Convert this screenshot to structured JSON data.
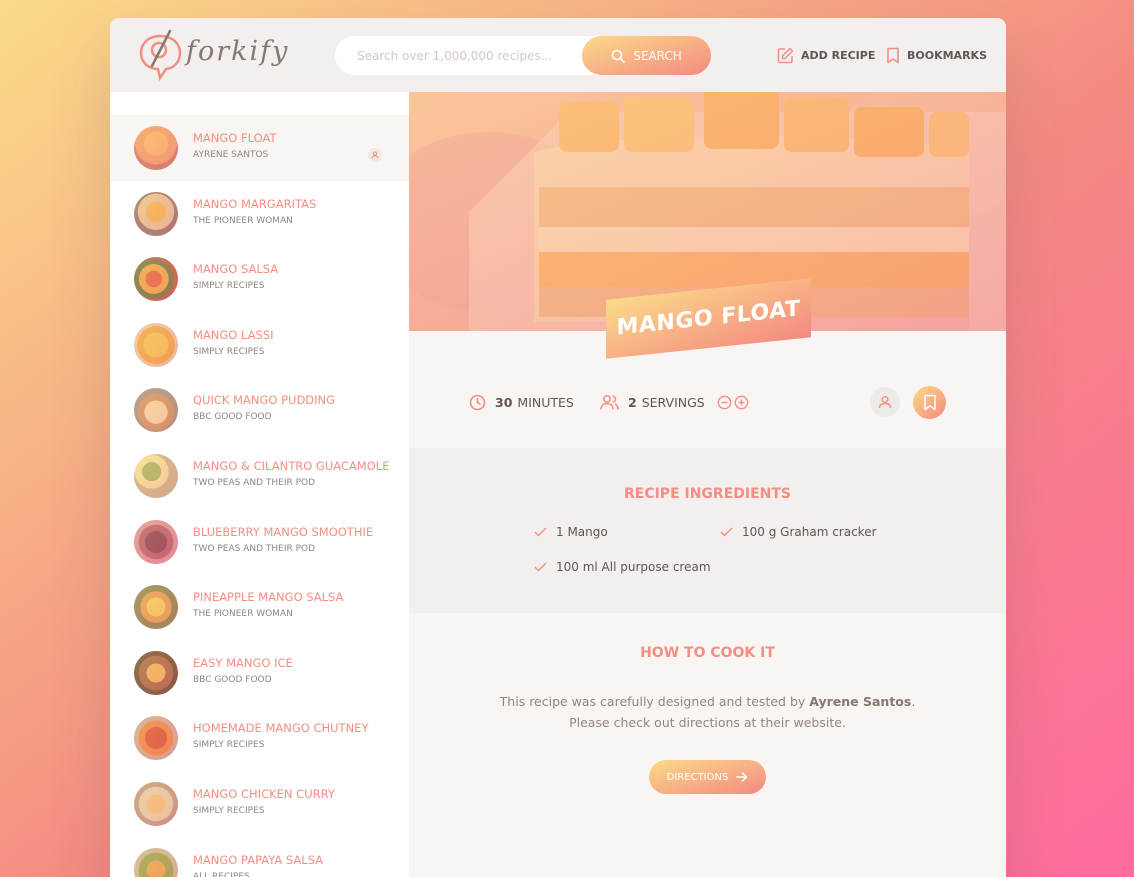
{
  "app": {
    "logo_text": "forkify",
    "colors": {
      "primary": "#f38e82",
      "accent_light": "#fbdb89",
      "accent_dark": "#f48982",
      "text": "#615551",
      "muted": "#918581"
    }
  },
  "header": {
    "search_placeholder": "Search over 1,000,000 recipes...",
    "search_value": "",
    "search_label": "SEARCH",
    "add_recipe_label": "ADD RECIPE",
    "bookmarks_label": "BOOKMARKS"
  },
  "results": [
    {
      "title": "MANGO FLOAT",
      "publisher": "AYRENE SANTOS",
      "active": true,
      "user_generated": true,
      "thumb": "cake-orange"
    },
    {
      "title": "MANGO MARGARITAS",
      "publisher": "THE PIONEER WOMAN",
      "active": false,
      "thumb": "drink-orange"
    },
    {
      "title": "MANGO SALSA",
      "publisher": "SIMPLY RECIPES",
      "active": false,
      "thumb": "salsa-red"
    },
    {
      "title": "MANGO LASSI",
      "publisher": "SIMPLY RECIPES",
      "active": false,
      "thumb": "lassi-yellow"
    },
    {
      "title": "QUICK MANGO PUDDING",
      "publisher": "BBC GOOD FOOD",
      "active": false,
      "thumb": "pudding-cream"
    },
    {
      "title": "MANGO & CILANTRO GUACAMOLE",
      "publisher": "TWO PEAS AND THEIR POD",
      "active": false,
      "thumb": "guac-green"
    },
    {
      "title": "BLUEBERRY MANGO SMOOTHIE",
      "publisher": "TWO PEAS AND THEIR POD",
      "active": false,
      "thumb": "smoothie-purple"
    },
    {
      "title": "PINEAPPLE MANGO SALSA",
      "publisher": "THE PIONEER WOMAN",
      "active": false,
      "thumb": "salsa-yellow"
    },
    {
      "title": "EASY MANGO ICE",
      "publisher": "BBC GOOD FOOD",
      "active": false,
      "thumb": "ice-brown"
    },
    {
      "title": "HOMEMADE MANGO CHUTNEY",
      "publisher": "SIMPLY RECIPES",
      "active": false,
      "thumb": "chutney-red"
    },
    {
      "title": "MANGO CHICKEN CURRY",
      "publisher": "SIMPLY RECIPES",
      "active": false,
      "thumb": "curry-cream"
    },
    {
      "title": "MANGO PAPAYA SALSA",
      "publisher": "ALL RECIPES",
      "active": false,
      "thumb": "salsa-green"
    }
  ],
  "recipe": {
    "title": "MANGO FLOAT",
    "cooking_time": "30",
    "cooking_time_unit": "MINUTES",
    "servings": "2",
    "servings_unit": "SERVINGS",
    "ingredients_title": "RECIPE INGREDIENTS",
    "ingredients": [
      "1 Mango",
      "100 g Graham cracker",
      "100 ml All purpose cream"
    ],
    "cook_title": "HOW TO COOK IT",
    "cook_text_before": "This recipe was carefully designed and tested by ",
    "cook_publisher": "Ayrene Santos",
    "cook_text_after": ". Please check out directions at their website.",
    "directions_label": "DIRECTIONS"
  }
}
